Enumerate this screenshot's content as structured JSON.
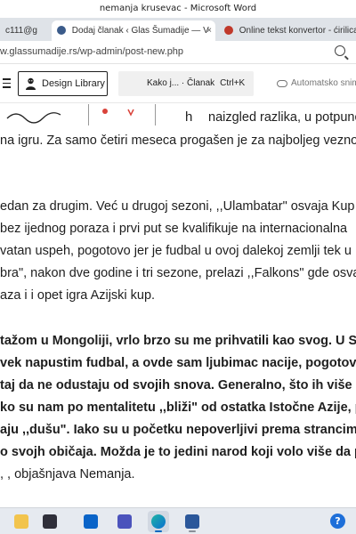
{
  "window": {
    "title": "nemanja krusevac - Microsoft Word"
  },
  "tabs": [
    {
      "label": "c111@g",
      "close": "×"
    },
    {
      "label": "Dodaj članak ‹ Glas Šumadije — V",
      "close": "×"
    },
    {
      "label": "Online tekst konvertor - ćirilica u",
      "close": ""
    }
  ],
  "address": {
    "url": "w.glassumadije.rs/wp-admin/post-new.php"
  },
  "editor_toolbar": {
    "design_library_label": "Design Library",
    "command_label": "Kako j... · Članak",
    "command_shortcut": "Ctrl+K",
    "autosave_label": "Automatsko snim"
  },
  "article": {
    "fragment_top": "h",
    "paragraphs": [
      {
        "text": "naizgled razlika,  u potpunos",
        "bold": false
      },
      {
        "text": "na igru.  Za samo četiri meseca progašen je za najboljeg veznog",
        "bold": false
      },
      {
        "text": "edan za drugim. Već u drugoj sezoni, ,,Ulambatar\" osvaja Kup",
        "bold": false
      },
      {
        "text": "bez ijednog poraza i prvi put se kvalifikuje na internacionalna",
        "bold": false
      },
      {
        "text": "vatan uspeh, pogotovo jer je fudbal u ovoj dalekoj zemlji  tek u",
        "bold": false
      },
      {
        "text": "bra\", nakon dve godine i tri sezone, prelazi ,,Falkons\" gde osvaja",
        "bold": false
      },
      {
        "text": "aza i i opet igra Azijski kup.",
        "bold": false
      },
      {
        "text": "tažom u Mongoliji, vrlo brzo su me prihvatili kao svog. U Srbiji",
        "bold": true
      },
      {
        "text": "vek napustim fudbal, a ovde sam ljubimac nacije, pogotovo ma",
        "bold": true
      },
      {
        "text": "taj da ne odustaju od svojih snova. Generalno,  što ih više",
        "bold": true
      },
      {
        "text": "ko su nam po mentalitetu ,,bliži\" od ostatka Istočne Azije, popu",
        "bold": true
      },
      {
        "text": "aju ,,dušu\". Iako su u početku nepoverljivi prema strancima, volo",
        "bold": true
      },
      {
        "text": "o svojh običaja. Možda je to jedini narod koji volo više da popije",
        "bold": true
      },
      {
        "text": ", ,  objašnjava Nemanja.",
        "bold": false
      }
    ]
  },
  "taskbar": {
    "apps": [
      "file-explorer",
      "store",
      "outlook",
      "teams",
      "edge",
      "word"
    ],
    "help_label": "?"
  },
  "colors": {
    "edge_active": "#0067c0",
    "word_blue": "#2b579a",
    "help_blue": "#1e6fd9"
  }
}
